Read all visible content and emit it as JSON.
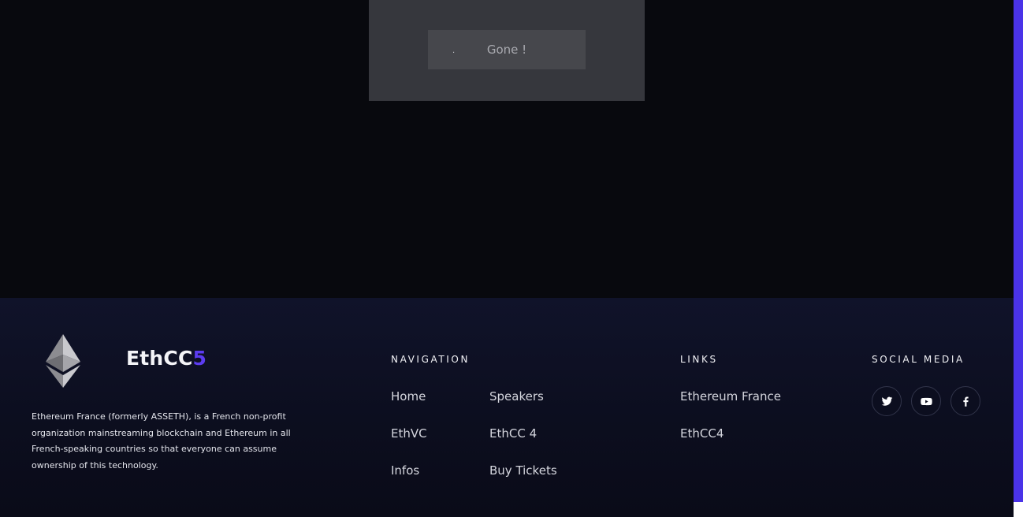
{
  "banner": {
    "button_dot": ".",
    "button_label": "Gone !"
  },
  "footer": {
    "brand": {
      "name": "EthCC",
      "number": "5"
    },
    "about": "Ethereum France (formerly ASSETH), is a French non-profit organization mainstreaming blockchain and Ethereum in all French-speaking countries so that everyone can assume ownership of this technology.",
    "navigation": {
      "heading": "NAVIGATION",
      "links": [
        "Home",
        "Speakers",
        "EthVC",
        "EthCC 4",
        "Infos",
        "Buy Tickets"
      ]
    },
    "links": {
      "heading": "LINKS",
      "items": [
        "Ethereum France",
        "EthCC4"
      ]
    },
    "social": {
      "heading": "SOCIAL MEDIA",
      "icons": [
        "twitter-icon",
        "youtube-icon",
        "facebook-icon"
      ]
    }
  },
  "colors": {
    "accent": "#4a33e8",
    "brand_accent": "#5c3cf0",
    "background": "#08090e",
    "footer_background": "#0c0e1f"
  }
}
